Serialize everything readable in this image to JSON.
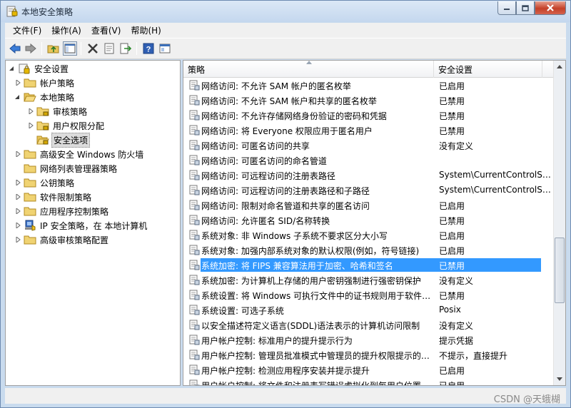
{
  "window": {
    "title": "本地安全策略"
  },
  "menu": [
    "文件(F)",
    "操作(A)",
    "查看(V)",
    "帮助(H)"
  ],
  "toolbar": [
    "back-icon",
    "forward-icon",
    "up-folder-icon",
    "show-hide-tree-icon",
    "delete-icon",
    "properties-icon",
    "export-icon",
    "help-icon",
    "mmc-icon"
  ],
  "tree": [
    {
      "label": "安全设置",
      "icon": "security-settings-icon",
      "level": 0,
      "expanded": true
    },
    {
      "label": "帐户策略",
      "icon": "folder-icon",
      "level": 1
    },
    {
      "label": "本地策略",
      "icon": "folder-open-icon",
      "level": 1,
      "expanded": true
    },
    {
      "label": "审核策略",
      "icon": "folder-icon",
      "level": 2
    },
    {
      "label": "用户权限分配",
      "icon": "folder-icon",
      "level": 2
    },
    {
      "label": "安全选项",
      "icon": "folder-open-icon",
      "level": 2,
      "selected": true
    },
    {
      "label": "高级安全 Windows 防火墙",
      "icon": "folder-icon",
      "level": 1
    },
    {
      "label": "网络列表管理器策略",
      "icon": "folder-icon",
      "level": 1
    },
    {
      "label": "公钥策略",
      "icon": "folder-icon",
      "level": 1
    },
    {
      "label": "软件限制策略",
      "icon": "folder-icon",
      "level": 1
    },
    {
      "label": "应用程序控制策略",
      "icon": "folder-icon",
      "level": 1
    },
    {
      "label": "IP 安全策略，在 本地计算机",
      "icon": "ip-security-icon",
      "level": 1
    },
    {
      "label": "高级审核策略配置",
      "icon": "folder-icon",
      "level": 1
    }
  ],
  "list": {
    "columns": [
      "策略",
      "安全设置"
    ],
    "rows": [
      {
        "name": "网络访问: 不允许 SAM 帐户的匿名枚举",
        "value": "已启用"
      },
      {
        "name": "网络访问: 不允许 SAM 帐户和共享的匿名枚举",
        "value": "已禁用"
      },
      {
        "name": "网络访问: 不允许存储网络身份验证的密码和凭据",
        "value": "已禁用"
      },
      {
        "name": "网络访问: 将 Everyone 权限应用于匿名用户",
        "value": "已禁用"
      },
      {
        "name": "网络访问: 可匿名访问的共享",
        "value": "没有定义"
      },
      {
        "name": "网络访问: 可匿名访问的命名管道",
        "value": ""
      },
      {
        "name": "网络访问: 可远程访问的注册表路径",
        "value": "System\\CurrentControlSet\\Control\\ProductOptions"
      },
      {
        "name": "网络访问: 可远程访问的注册表路径和子路径",
        "value": "System\\CurrentControlSet\\Control\\Print\\Printers"
      },
      {
        "name": "网络访问: 限制对命名管道和共享的匿名访问",
        "value": "已启用"
      },
      {
        "name": "网络访问: 允许匿名 SID/名称转换",
        "value": "已禁用"
      },
      {
        "name": "系统对象: 非 Windows 子系统不要求区分大小写",
        "value": "已启用"
      },
      {
        "name": "系统对象: 加强内部系统对象的默认权限(例如，符号链接)",
        "value": "已启用"
      },
      {
        "name": "系统加密: 将 FIPS 兼容算法用于加密、哈希和签名",
        "value": "已禁用",
        "selected": true
      },
      {
        "name": "系统加密: 为计算机上存储的用户密钥强制进行强密钥保护",
        "value": "没有定义"
      },
      {
        "name": "系统设置: 将 Windows 可执行文件中的证书规则用于软件限制策略",
        "value": "已禁用"
      },
      {
        "name": "系统设置: 可选子系统",
        "value": "Posix"
      },
      {
        "name": "以安全描述符定义语言(SDDL)语法表示的计算机访问限制",
        "value": "没有定义"
      },
      {
        "name": "用户帐户控制: 标准用户的提升提示行为",
        "value": "提示凭据"
      },
      {
        "name": "用户帐户控制: 管理员批准模式中管理员的提升权限提示的行为",
        "value": "不提示，直接提升"
      },
      {
        "name": "用户帐户控制: 检测应用程序安装并提示提升",
        "value": "已启用"
      },
      {
        "name": "用户帐户控制: 将文件和注册表写错误虚拟化到每用户位置",
        "value": "已启用"
      }
    ]
  },
  "watermark": "CSDN @天蛾楜"
}
